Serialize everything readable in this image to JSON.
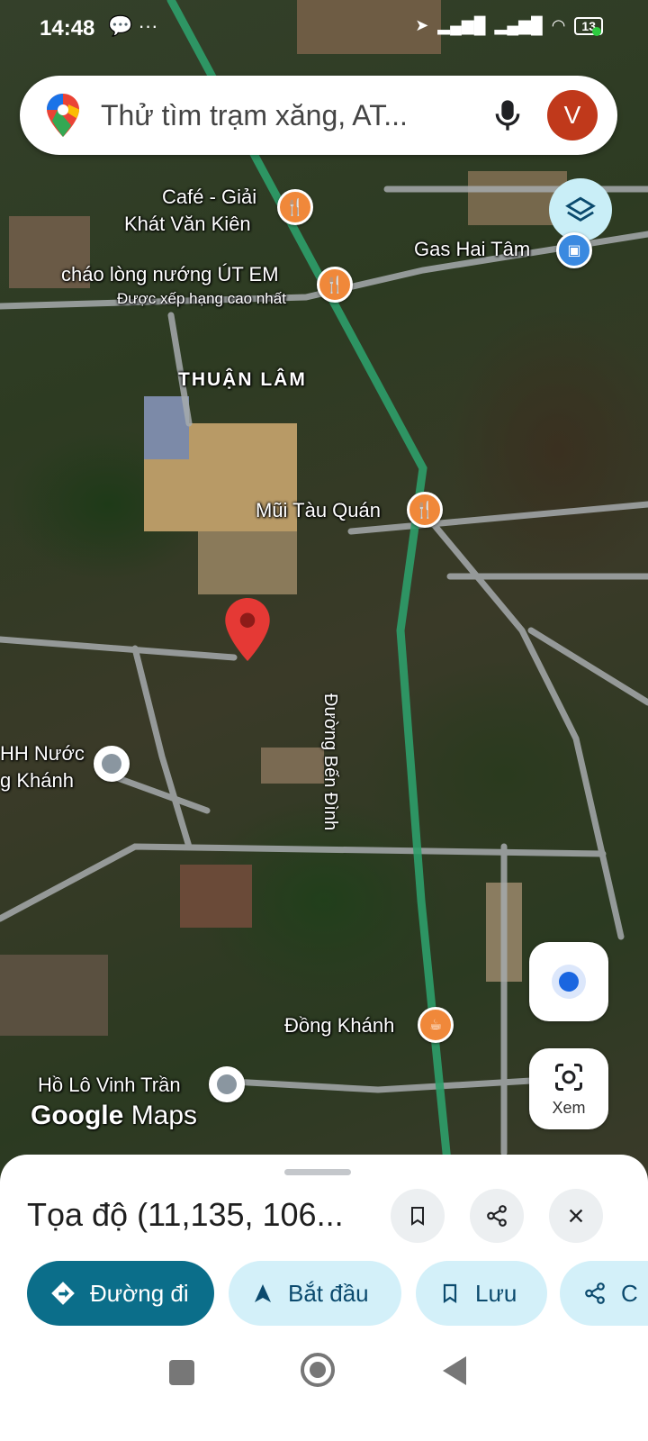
{
  "status_bar": {
    "time": "14:48",
    "left_icons": "💬 ···",
    "battery": "13"
  },
  "search": {
    "placeholder": "Thử tìm trạm xăng, AT...",
    "avatar_letter": "V",
    "icons": [
      "google-maps-pin-icon",
      "mic-icon"
    ]
  },
  "map": {
    "places": [
      {
        "name": "Café - Giải",
        "type": "restaurant"
      },
      {
        "name": "Khát Văn Kiên",
        "type": "restaurant"
      },
      {
        "name": "Gas Hai Tâm",
        "type": "shop"
      },
      {
        "name": "cháo lòng nướng ÚT EM",
        "type": "restaurant",
        "subtitle": "Được xếp hạng cao nhất"
      },
      {
        "name": "Mũi Tàu Quán",
        "type": "restaurant"
      },
      {
        "name": "HH Nước",
        "type": "place"
      },
      {
        "name": "g Khánh",
        "type": "place"
      },
      {
        "name": "Đồng Khánh",
        "type": "cafe"
      },
      {
        "name": "Hồ Lô Vinh Trần",
        "type": "place"
      }
    ],
    "area_label": "THUẬN LÂM",
    "road_label": "Đường Bến Đình",
    "logo": {
      "google": "Google",
      "maps": "Maps"
    },
    "lens_label": "Xem",
    "colors": {
      "poi_orange": "#f0883a",
      "poi_blue": "#3a89e0",
      "pin_red": "#e53935",
      "road_green": "#2e9e6a"
    }
  },
  "sheet": {
    "title": "Tọa độ (11,135, 106...",
    "chips": [
      {
        "label": "Đường đi",
        "icon": "directions-icon"
      },
      {
        "label": "Bắt đầu",
        "icon": "navigation-arrow-icon"
      },
      {
        "label": "Lưu",
        "icon": "bookmark-icon"
      },
      {
        "label": "C",
        "icon": "share-icon"
      }
    ],
    "accent": "#0b6e8a"
  }
}
